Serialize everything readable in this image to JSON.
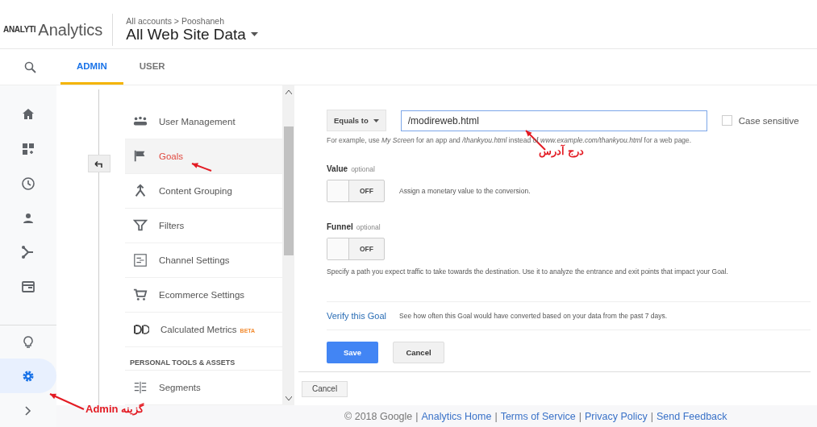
{
  "header": {
    "logo_text": "ANALYTI",
    "product": "Analytics",
    "breadcrumb": "All accounts > Pooshaneh",
    "view": "All Web Site Data"
  },
  "tabs": [
    {
      "label": "ADMIN",
      "selected": true
    },
    {
      "label": "USER",
      "selected": false
    }
  ],
  "rail": [
    {
      "selected": false
    },
    {
      "selected": false
    },
    {
      "selected": false
    },
    {
      "selected": false
    },
    {
      "selected": false
    },
    {
      "selected": false
    },
    {
      "selected": false
    },
    {
      "selected": true
    },
    {
      "selected": false
    }
  ],
  "menu": [
    {
      "kind": "item",
      "label": "User Management",
      "selected": false
    },
    {
      "kind": "item",
      "label": "Goals",
      "selected": true
    },
    {
      "kind": "item",
      "label": "Content Grouping",
      "selected": false
    },
    {
      "kind": "item",
      "label": "Filters",
      "selected": false
    },
    {
      "kind": "item",
      "label": "Channel Settings",
      "selected": false
    },
    {
      "kind": "item",
      "label": "Ecommerce Settings",
      "selected": false
    },
    {
      "kind": "item",
      "label": "Calculated Metrics",
      "badge": "BETA",
      "selected": false
    },
    {
      "kind": "section",
      "label": "PERSONAL TOOLS & ASSETS"
    },
    {
      "kind": "item",
      "label": "Segments",
      "selected": false
    }
  ],
  "goal_form": {
    "operator": "Equals to",
    "value": "/modireweb.html",
    "case_sensitive": {
      "label": "Case sensitive",
      "checked": false
    },
    "hint": "For example, use *My Screen* for an app and */thankyou.html* instead of *www.example.com/thankyou.html* for a web page.",
    "options": [
      {
        "kind": "inline",
        "label": "Value",
        "tag": "optional",
        "toggle": {
          "on": false,
          "text": "OFF"
        },
        "description": "Assign a monetary value to the conversion."
      },
      {
        "kind": "below",
        "label": "Funnel",
        "tag": "optional",
        "toggle": {
          "on": false,
          "text": "OFF"
        },
        "description": "Specify a path you expect traffic to take towards the destination. Use it to analyze the entrance and exit points that impact your Goal."
      }
    ],
    "verify": {
      "link": "Verify this Goal",
      "text": "See how often this Goal would have converted based on your data from the past 7 days."
    },
    "buttons": [
      {
        "kind": "primary",
        "label": "Save"
      },
      {
        "kind": "secondary",
        "label": "Cancel"
      }
    ]
  },
  "lower_button": "Cancel",
  "footer": [
    {
      "kind": "text",
      "text": "© 2018 Google"
    },
    {
      "kind": "separator",
      "text": "|"
    },
    {
      "kind": "link",
      "text": "Analytics Home"
    },
    {
      "kind": "separator",
      "text": "|"
    },
    {
      "kind": "link",
      "text": "Terms of Service"
    },
    {
      "kind": "separator",
      "text": "|"
    },
    {
      "kind": "link",
      "text": "Privacy Policy"
    },
    {
      "kind": "separator",
      "text": "|"
    },
    {
      "kind": "link",
      "text": "Send Feedback"
    }
  ],
  "annotations": [
    "درج آدرس",
    "گزینه Admin"
  ]
}
